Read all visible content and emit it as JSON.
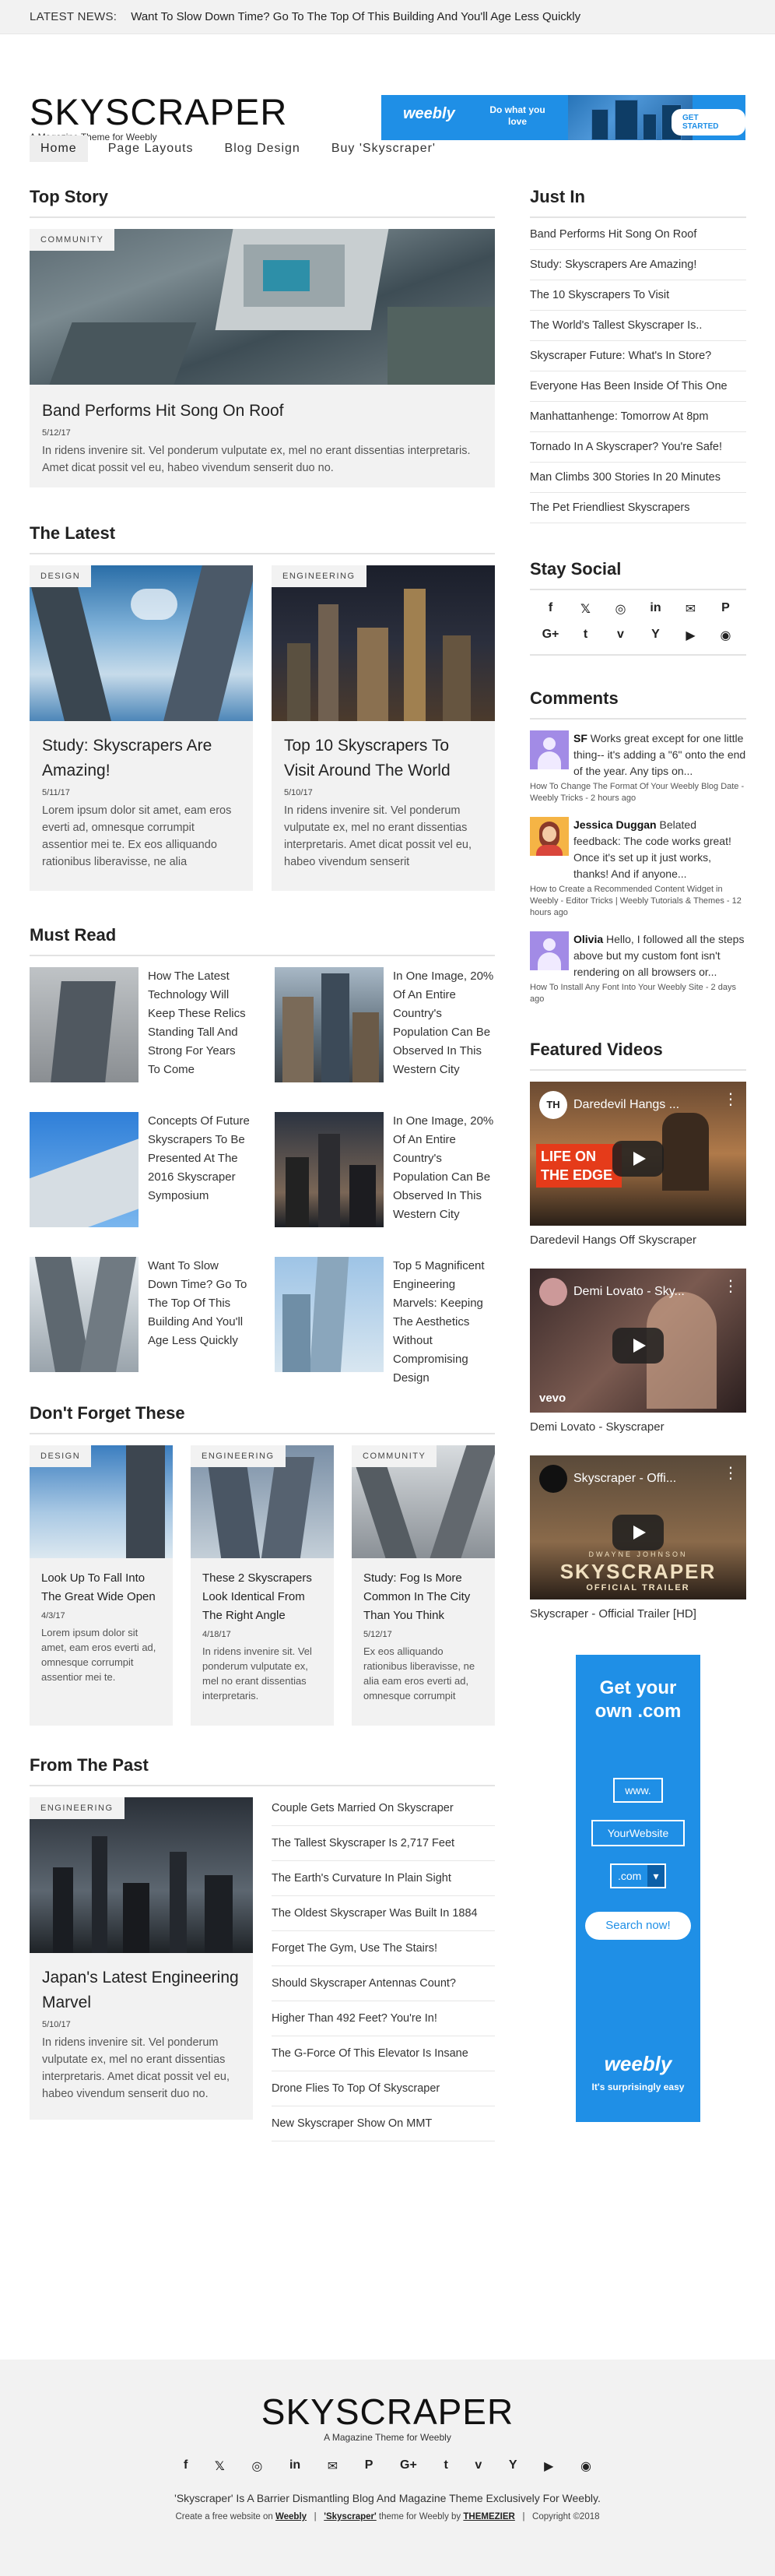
{
  "ticker": {
    "label": "LATEST NEWS:",
    "text": "Want To Slow Down Time? Go To The Top Of This Building And You'll Age Less Quickly"
  },
  "site": {
    "logo": "SKYSCRAPER",
    "tagline": "A Magazine Theme for Weebly"
  },
  "top_ad": {
    "logo": "weebly",
    "slogan": "Do what you love",
    "cta": "GET STARTED"
  },
  "nav": [
    {
      "label": "Home"
    },
    {
      "label": "Page Layouts"
    },
    {
      "label": "Blog Design"
    },
    {
      "label": "Buy 'Skyscraper'"
    }
  ],
  "top_story": {
    "heading": "Top Story",
    "category": "COMMUNITY",
    "title": "Band Performs Hit Song On Roof",
    "date": "5/12/17",
    "excerpt": "In ridens invenire sit. Vel ponderum vulputate ex, mel no erant dissentias interpretaris. Amet dicat possit vel eu, habeo vivendum senserit duo no."
  },
  "latest": {
    "heading": "The Latest",
    "items": [
      {
        "category": "DESIGN",
        "title": "Study: Skyscrapers Are Amazing!",
        "date": "5/11/17",
        "excerpt": "Lorem ipsum dolor sit amet, eam eros everti ad, omnesque corrumpit assentior mei te. Ex eos alliquando rationibus liberavisse, ne alia"
      },
      {
        "category": "ENGINEERING",
        "title": "Top 10 Skyscrapers To Visit Around The World",
        "date": "5/10/17",
        "excerpt": "In ridens invenire sit. Vel ponderum vulputate ex, mel no erant dissentias interpretaris. Amet dicat possit vel eu, habeo vivendum senserit"
      }
    ]
  },
  "must_read": {
    "heading": "Must Read",
    "items": [
      {
        "title": "How The Latest Technology Will Keep These Relics Standing Tall And Strong For Years To Come"
      },
      {
        "title": "In One Image, 20% Of An Entire Country's Population Can Be Observed In This Western City"
      },
      {
        "title": "Concepts Of Future Skyscrapers To Be Presented At The 2016 Skyscraper Symposium"
      },
      {
        "title": "In One Image, 20% Of An Entire Country's Population Can Be Observed In This Western City"
      },
      {
        "title": "Want To Slow Down Time? Go To The Top Of This Building And You'll Age Less Quickly"
      },
      {
        "title": "Top 5 Magnificent Engineering Marvels: Keeping The Aesthetics Without Compromising Design"
      }
    ]
  },
  "dont_forget": {
    "heading": "Don't Forget These",
    "items": [
      {
        "category": "DESIGN",
        "title": "Look Up To Fall Into The Great Wide Open",
        "date": "4/3/17",
        "excerpt": "Lorem ipsum dolor sit amet, eam eros everti ad, omnesque corrumpit assentior mei te."
      },
      {
        "category": "ENGINEERING",
        "title": "These 2 Skyscrapers Look Identical From The Right Angle",
        "date": "4/18/17",
        "excerpt": "In ridens invenire sit. Vel ponderum vulputate ex, mel no erant dissentias interpretaris."
      },
      {
        "category": "COMMUNITY",
        "title": "Study: Fog Is More Common In The City Than You Think",
        "date": "5/12/17",
        "excerpt": "Ex eos alliquando rationibus liberavisse, ne alia eam eros everti ad, omnesque corrumpit"
      }
    ]
  },
  "from_past": {
    "heading": "From The Past",
    "feature": {
      "category": "ENGINEERING",
      "title": "Japan's Latest Engineering Marvel",
      "date": "5/10/17",
      "excerpt": "In ridens invenire sit. Vel ponderum vulputate ex, mel no erant dissentias interpretaris. Amet dicat possit vel eu, habeo vivendum senserit duo no."
    },
    "links": [
      "Couple Gets Married On Skyscraper",
      "The Tallest Skyscraper Is 2,717 Feet",
      "The Earth's Curvature In Plain Sight",
      "The Oldest Skyscraper Was Built In 1884",
      "Forget The Gym, Use The Stairs!",
      "Should Skyscraper Antennas Count?",
      "Higher Than 492 Feet? You're In!",
      "The G-Force Of This Elevator Is Insane",
      "Drone Flies To Top Of Skyscraper",
      "New Skyscraper Show On MMT"
    ]
  },
  "just_in": {
    "heading": "Just In",
    "links": [
      "Band Performs Hit Song On Roof",
      "Study: Skyscrapers Are Amazing!",
      "The 10 Skyscrapers To Visit",
      "The World's Tallest Skyscraper Is..",
      "Skyscraper Future: What's In Store?",
      "Everyone Has Been Inside Of This One",
      "Manhattanhenge: Tomorrow At 8pm",
      "Tornado In A Skyscraper? You're Safe!",
      "Man Climbs 300 Stories In 20 Minutes",
      "The Pet Friendliest Skyscrapers"
    ]
  },
  "stay_social": {
    "heading": "Stay Social",
    "icons": [
      "f",
      "𝕏",
      "◎",
      "in",
      "✉",
      "P",
      "G+",
      "t",
      "v",
      "Y",
      "▶",
      "◉"
    ]
  },
  "comments": {
    "heading": "Comments",
    "items": [
      {
        "author": "SF",
        "text": " Works great except for one little thing-- it's adding a \"6\" onto the end of the year. Any tips on...",
        "meta": "How To Change The Format Of Your Weebly Blog Date - Weebly Tricks - 2 hours ago"
      },
      {
        "author": "Jessica Duggan",
        "text": " Belated feedback: The code works great! Once it's set up it just works, thanks! And if anyone...",
        "meta": "How to Create a Recommended Content Widget in Weebly - Editor Tricks | Weebly Tutorials & Themes - 12 hours ago"
      },
      {
        "author": "Olivia",
        "text": " Hello, I followed all the steps above but my custom font isn't rendering on all browsers or...",
        "meta": "How To Install Any Font Into Your Weebly Site - 2 days ago"
      }
    ]
  },
  "videos": {
    "heading": "Featured Videos",
    "items": [
      {
        "overlay": "Daredevil Hangs ...",
        "caption": "Daredevil Hangs Off Skyscraper",
        "badge": "LIFE ON THE EDGE",
        "channel": "TH"
      },
      {
        "overlay": "Demi Lovato - Sky...",
        "caption": "Demi Lovato - Skyscraper",
        "badge": "vevo"
      },
      {
        "overlay": "Skyscraper - Offi...",
        "caption": "Skyscraper - Official Trailer [HD]",
        "badge": "SKYSCRAPER",
        "sub": "OFFICIAL TRAILER",
        "top": "DWAYNE JOHNSON"
      }
    ]
  },
  "side_ad": {
    "headline": "Get your own .com",
    "www": "www.",
    "site": "YourWebsite",
    "tld": ".com",
    "cta": "Search now!",
    "logo": "weebly",
    "slogan": "It's surprisingly easy"
  },
  "footer": {
    "logo": "SKYSCRAPER",
    "tagline": "A Magazine Theme for Weebly",
    "icons": [
      "f",
      "𝕏",
      "◎",
      "in",
      "✉",
      "P",
      "G+",
      "t",
      "v",
      "Y",
      "▶",
      "◉"
    ],
    "desc": "'Skyscraper' Is A Barrier Dismantling Blog And Magazine Theme Exclusively For Weebly.",
    "credit_1": "Create a free website on ",
    "weebly": "Weebly",
    "sep": "|",
    "theme": "'Skyscraper'",
    "credit_2": " theme for Weebly by ",
    "author": "THEMEZIER",
    "copyright": "Copyright ©2018"
  }
}
